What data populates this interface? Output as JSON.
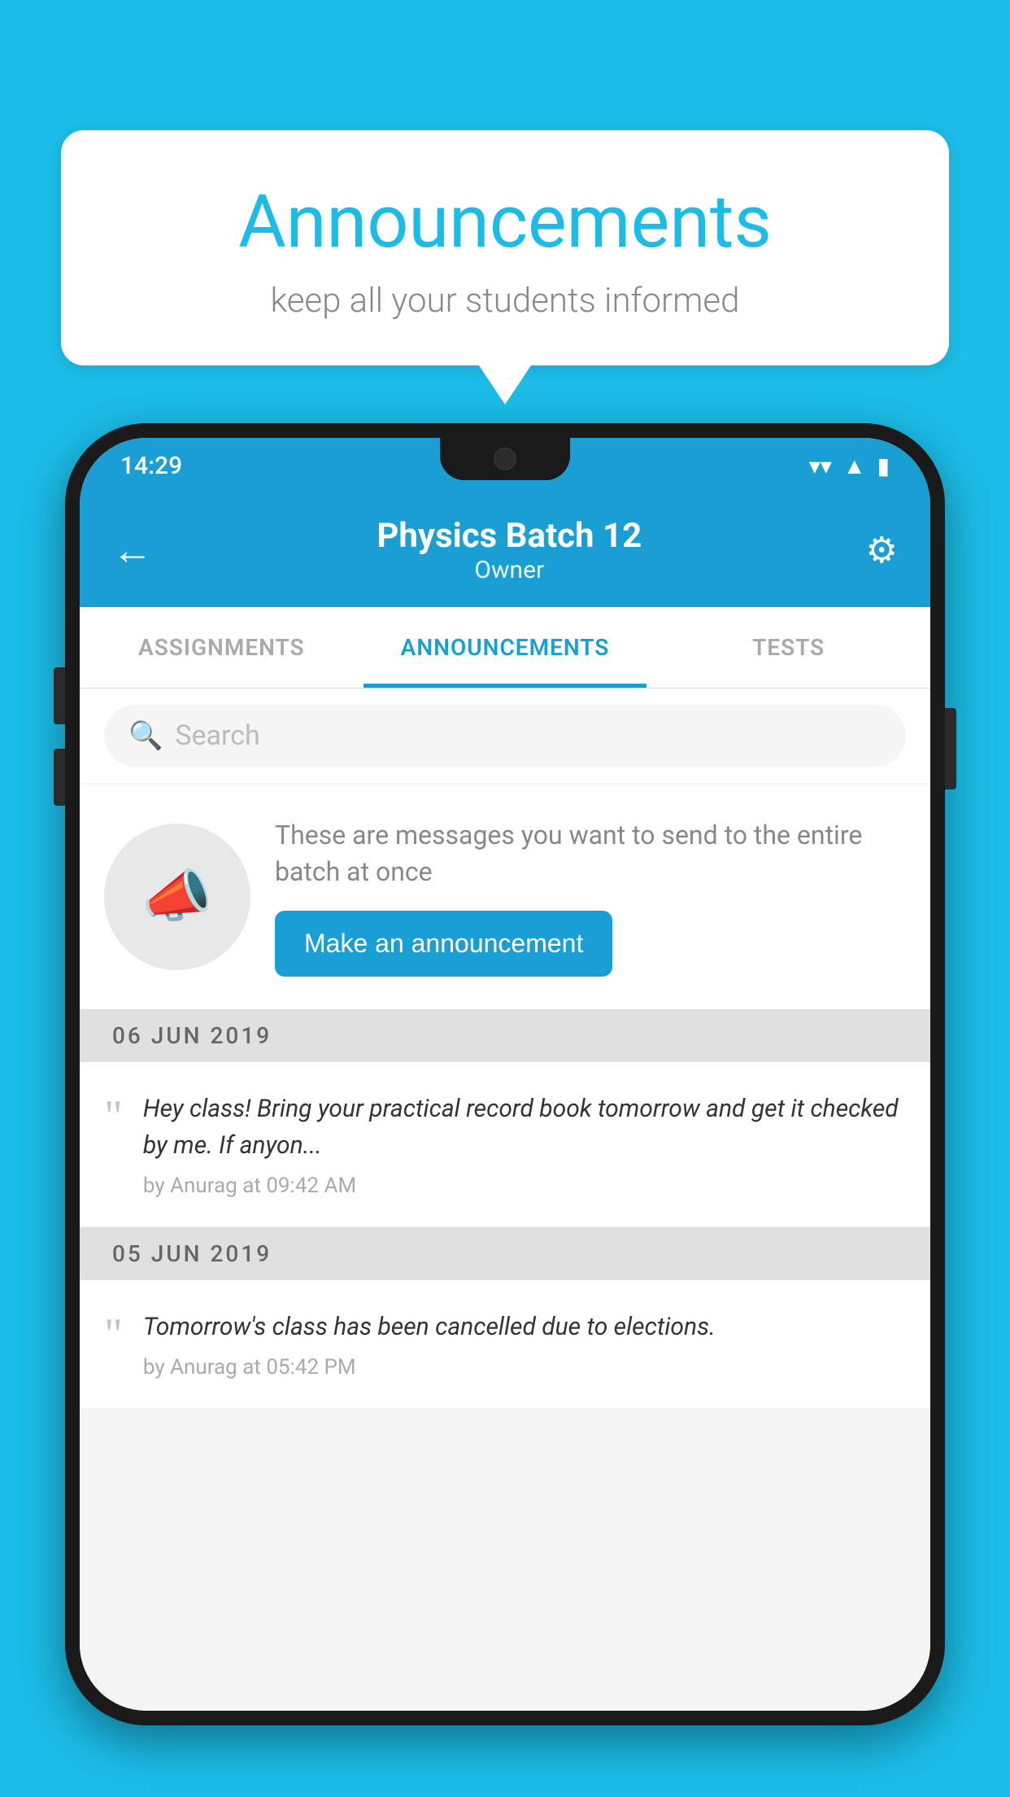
{
  "background": {
    "color": "#1bbde8"
  },
  "speech_bubble": {
    "title": "Announcements",
    "subtitle": "keep all your students informed"
  },
  "phone": {
    "status_bar": {
      "time": "14:29",
      "wifi": "▼",
      "signal": "▲",
      "battery": "▮"
    },
    "header": {
      "title": "Physics Batch 12",
      "subtitle": "Owner",
      "back_label": "←",
      "settings_label": "⚙"
    },
    "tabs": [
      {
        "label": "ASSIGNMENTS",
        "active": false
      },
      {
        "label": "ANNOUNCEMENTS",
        "active": true
      },
      {
        "label": "TESTS",
        "active": false
      }
    ],
    "search": {
      "placeholder": "Search"
    },
    "promo": {
      "description": "These are messages you want to send to the entire batch at once",
      "button_label": "Make an announcement"
    },
    "announcements": [
      {
        "date": "06  JUN  2019",
        "text": "Hey class! Bring your practical record book tomorrow and get it checked by me. If anyon...",
        "meta": "by Anurag at 09:42 AM"
      },
      {
        "date": "05  JUN  2019",
        "text": "Tomorrow's class has been cancelled due to elections.",
        "meta": "by Anurag at 05:42 PM"
      }
    ]
  }
}
